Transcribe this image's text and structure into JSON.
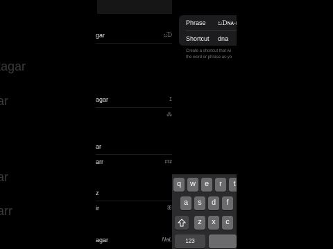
{
  "background_words": [
    "tagar",
    "ar",
    "ar",
    "arr"
  ],
  "list_rows": [
    {
      "label": "gar",
      "value": "ಬ͡ᗪ"
    },
    {
      "label": "agar",
      "value": "ꕯ"
    },
    {
      "label": "",
      "value": "⁂"
    },
    {
      "label": "ar",
      "value": ""
    },
    {
      "label": "arr",
      "value": "ɪᴛᴢ"
    },
    {
      "label": "z",
      "value": ""
    },
    {
      "label": "ir",
      "value": "ꕥ"
    },
    {
      "label": "agar",
      "value": "NaL"
    }
  ],
  "settings": {
    "phrase_label": "Phrase",
    "phrase_value": "ಬᗪɴᴀ-ʜ",
    "shortcut_label": "Shortcut",
    "shortcut_value": "dna",
    "hint_line1": "Create a shortcut that wi",
    "hint_line2": "the word or phrase as yo"
  },
  "keyboard": {
    "row1": [
      "q",
      "w",
      "e",
      "r",
      "t"
    ],
    "row2": [
      "a",
      "s",
      "d",
      "f"
    ],
    "row3": [
      "z",
      "x",
      "c"
    ],
    "shift_icon": "shift-icon",
    "numbers_label": "123"
  }
}
